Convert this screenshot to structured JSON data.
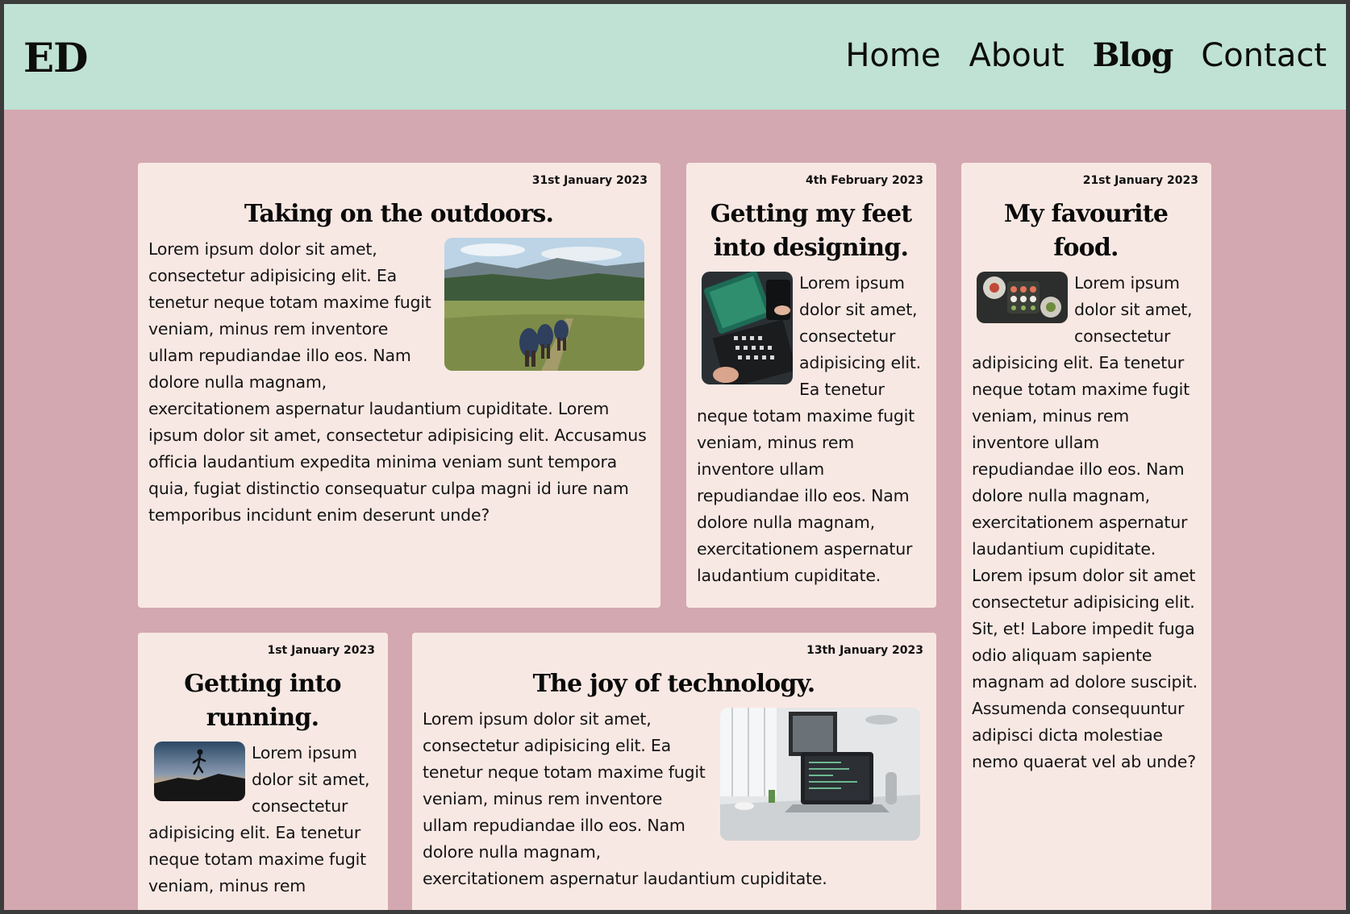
{
  "site": {
    "logo": "ED"
  },
  "nav": {
    "home": "Home",
    "about": "About",
    "blog": "Blog",
    "contact": "Contact"
  },
  "posts": [
    {
      "date": "31st January 2023",
      "title": "Taking on the outdoors.",
      "image_icon": "hikers-photo",
      "body": "Lorem ipsum dolor sit amet, consectetur adipisicing elit. Ea tenetur neque totam maxime fugit veniam, minus rem inventore ullam repudiandae illo eos. Nam dolore nulla magnam, exercitationem aspernatur laudantium cupiditate. Lorem ipsum dolor sit amet, consectetur adipisicing elit. Accusamus officia laudantium expedita minima veniam sunt tempora quia, fugiat distinctio consequatur culpa magni id iure nam temporibus incidunt enim deserunt unde?"
    },
    {
      "date": "4th February 2023",
      "title": "Getting my feet into designing.",
      "image_icon": "laptop-keyboard-photo",
      "body": "Lorem ipsum dolor sit amet, consectetur adipisicing elit. Ea tenetur neque totam maxime fugit veniam, minus rem inventore ullam repudiandae illo eos. Nam dolore nulla magnam, exercitationem aspernatur laudantium cupiditate."
    },
    {
      "date": "21st January 2023",
      "title": "My favourite food.",
      "image_icon": "sushi-photo",
      "body": "Lorem ipsum dolor sit amet, consectetur adipisicing elit. Ea tenetur neque totam maxime fugit veniam, minus rem inventore ullam repudiandae illo eos. Nam dolore nulla magnam, exercitationem aspernatur laudantium cupiditate. Lorem ipsum dolor sit amet consectetur adipisicing elit. Sit, et! Labore impedit fuga odio aliquam sapiente magnam ad dolore suscipit. Assumenda consequuntur adipisci dicta molestiae nemo quaerat vel ab unde?"
    },
    {
      "date": "1st January 2023",
      "title": "Getting into running.",
      "image_icon": "runner-silhouette-photo",
      "body": "Lorem ipsum dolor sit amet, consectetur adipisicing elit. Ea tenetur neque totam maxime fugit veniam, minus rem"
    },
    {
      "date": "13th January 2023",
      "title": "The joy of technology.",
      "image_icon": "laptop-desk-photo",
      "body": "Lorem ipsum dolor sit amet, consectetur adipisicing elit. Ea tenetur neque totam maxime fugit veniam, minus rem inventore ullam repudiandae illo eos. Nam dolore nulla magnam, exercitationem aspernatur laudantium cupiditate."
    }
  ],
  "colors": {
    "header": "#bfe2d4",
    "page": "#d4a8b0",
    "card": "#f8e8e3",
    "text": "#0d0d0d"
  }
}
